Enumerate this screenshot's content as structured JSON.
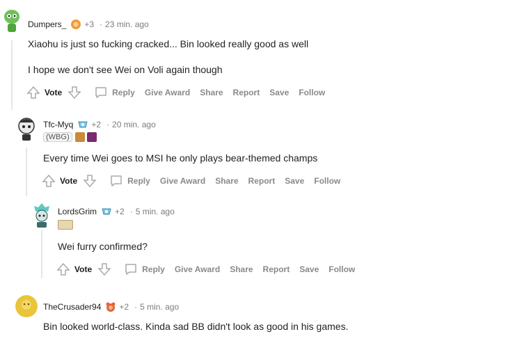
{
  "comments": [
    {
      "user": "Dumpers_",
      "award_count": "+3",
      "time": "23 min. ago",
      "body": [
        "Xiaohu is just so fucking cracked... Bin looked really good as well",
        "I hope we don't see Wei on Voli again though"
      ]
    },
    {
      "user": "Tfc-Myq",
      "award_count": "+2",
      "time": "20 min. ago",
      "flair": "(WBG)",
      "body": [
        "Every time Wei goes to MSI he only plays bear-themed champs"
      ]
    },
    {
      "user": "LordsGrim",
      "award_count": "+2",
      "time": "5 min. ago",
      "body": [
        "Wei furry confirmed?"
      ]
    },
    {
      "user": "TheCrusader94",
      "award_count": "+2",
      "time": "5 min. ago",
      "body": [
        "Bin looked world-class. Kinda sad BB didn't look as good in his games."
      ]
    }
  ],
  "actions": {
    "vote": "Vote",
    "reply": "Reply",
    "give_award": "Give Award",
    "share": "Share",
    "report": "Report",
    "save": "Save",
    "follow": "Follow"
  },
  "separator": "·"
}
